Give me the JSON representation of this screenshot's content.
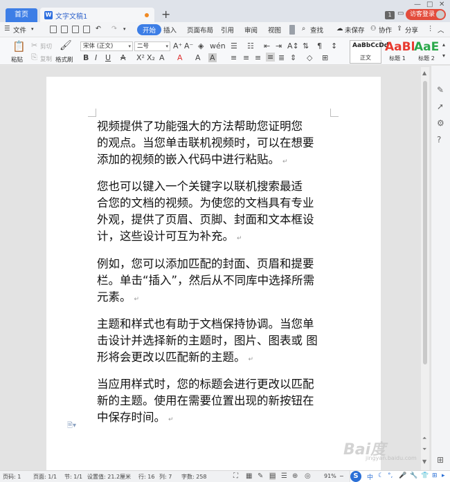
{
  "titlebar": {
    "home_tab": "首页",
    "doc_tab": "文字文稿1",
    "new_tab": "+",
    "badge": "1",
    "guest_login": "访客登录"
  },
  "menu": {
    "file": "文件",
    "tabs": [
      "开始",
      "插入",
      "页面布局",
      "引用",
      "审阅",
      "视图"
    ],
    "search": "查找",
    "unsaved": "未保存",
    "collab": "协作",
    "share": "分享"
  },
  "ribbon": {
    "paste": "粘贴",
    "cut": "剪切",
    "copy": "复制",
    "format_painter": "格式刷",
    "font_name": "宋体 (正文)",
    "font_size": "二号",
    "styles": [
      {
        "sample": "AaBbCcDd",
        "name": "正文"
      },
      {
        "sample": "AaBl",
        "name": "标题 1"
      },
      {
        "sample": "AaE",
        "name": "标题 2"
      }
    ]
  },
  "document": {
    "paragraphs": [
      [
        "视频提供了功能强大的方法帮助您证明您",
        "的观点。当您单击联机视频时，可以在想要",
        "添加的视频的嵌入代码中进行粘贴。"
      ],
      [
        "您也可以键入一个关键字以联机搜索最适",
        "合您的文档的视频。为使您的文档具有专业",
        "外观，提供了页眉、页脚、封面和文本框设",
        "计，这些设计可互为补充。"
      ],
      [
        "例如，您可以添加匹配的封面、页眉和提要",
        "栏。单击“插入”，然后从不同库中选择所需",
        "元素。"
      ],
      [
        "主题和样式也有助于文档保持协调。当您单",
        "击设计并选择新的主题时，图片、图表或 图",
        "形将会更改以匹配新的主题。"
      ],
      [
        "当应用样式时，您的标题会进行更改以匹配",
        "新的主题。使用在需要位置出现的新按钮在",
        "中保存时间。"
      ]
    ]
  },
  "status": {
    "page_num": "页码: 1",
    "pages": "页面: 1/1",
    "section": "节: 1/1",
    "position": "设置值: 21.2厘米",
    "row": "行: 16",
    "col": "列: 7",
    "word_count": "字数: 258",
    "zoom": "91%",
    "ime_lang": "中"
  },
  "watermark": {
    "text": "Bai度",
    "sub": "jingyan.baidu.com"
  },
  "colors": {
    "accent": "#3d7ee6",
    "guest": "#e34c3c",
    "style_red": "#e83a2f",
    "style_green": "#2aa84a"
  }
}
